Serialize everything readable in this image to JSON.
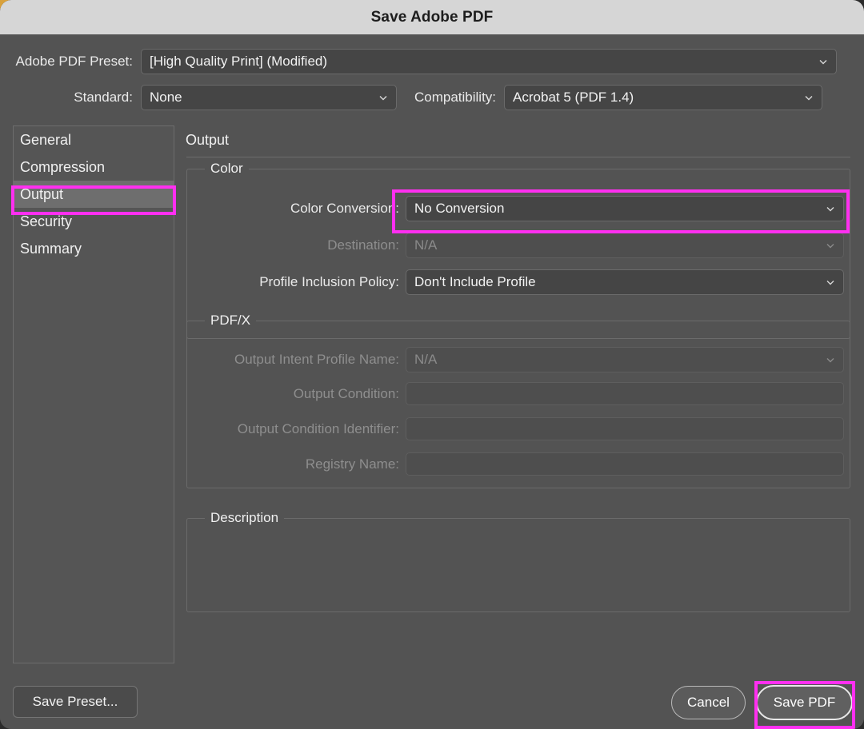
{
  "window": {
    "title": "Save Adobe PDF"
  },
  "preset": {
    "label": "Adobe PDF Preset:",
    "value": "[High Quality Print] (Modified)"
  },
  "standard": {
    "label": "Standard:",
    "value": "None"
  },
  "compatibility": {
    "label": "Compatibility:",
    "value": "Acrobat 5 (PDF 1.4)"
  },
  "sidebar": {
    "items": [
      {
        "label": "General",
        "selected": false
      },
      {
        "label": "Compression",
        "selected": false
      },
      {
        "label": "Output",
        "selected": true
      },
      {
        "label": "Security",
        "selected": false
      },
      {
        "label": "Summary",
        "selected": false
      }
    ]
  },
  "pane": {
    "title": "Output"
  },
  "color_group": {
    "legend": "Color",
    "color_conversion": {
      "label": "Color Conversion:",
      "value": "No Conversion",
      "disabled": false
    },
    "destination": {
      "label": "Destination:",
      "value": "N/A",
      "disabled": true
    },
    "profile_inclusion_policy": {
      "label": "Profile Inclusion Policy:",
      "value": "Don't Include Profile",
      "disabled": false
    }
  },
  "pdfx_group": {
    "legend": "PDF/X",
    "output_intent_profile_name": {
      "label": "Output Intent Profile Name:",
      "value": "N/A",
      "disabled": true
    },
    "output_condition": {
      "label": "Output Condition:",
      "value": "",
      "disabled": true
    },
    "output_condition_identifier": {
      "label": "Output Condition Identifier:",
      "value": "",
      "disabled": true
    },
    "registry_name": {
      "label": "Registry Name:",
      "value": "",
      "disabled": true
    }
  },
  "description_group": {
    "legend": "Description",
    "text": ""
  },
  "footer": {
    "save_preset": "Save Preset...",
    "cancel": "Cancel",
    "save_pdf": "Save PDF"
  },
  "colors": {
    "highlight": "#ff2ff0",
    "dialog_bg": "#535353",
    "titlebar_bg": "#d6d6d6",
    "selected_row": "#6e6e6e"
  }
}
